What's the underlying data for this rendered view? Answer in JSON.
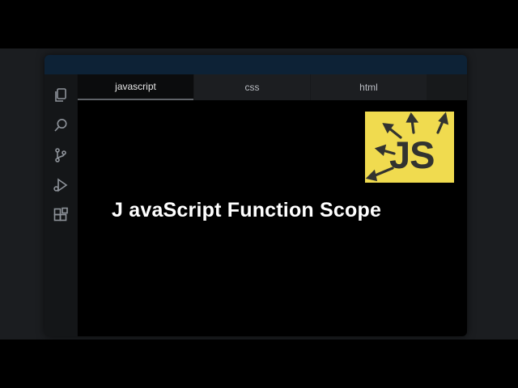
{
  "tabs": [
    {
      "label": "javascript",
      "active": true
    },
    {
      "label": "css",
      "active": false
    },
    {
      "label": "html",
      "active": false
    }
  ],
  "activity_icons": [
    "files-icon",
    "search-icon",
    "source-control-icon",
    "run-debug-icon",
    "extensions-icon"
  ],
  "editor": {
    "title": "J avaScript Function Scope",
    "logo_text": "JS"
  },
  "colors": {
    "background": "#000000",
    "panel": "#1b1d20",
    "titlebar": "#0d2236",
    "logo_bg": "#f0db4f",
    "logo_fg": "#323330"
  }
}
